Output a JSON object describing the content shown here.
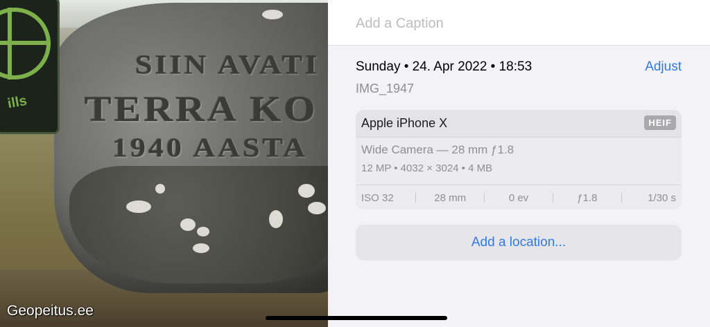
{
  "photo": {
    "inscription_lines": [
      "SIIN AVATI",
      "TERRA KO",
      "1940 AASTA"
    ],
    "patch_text": "ills",
    "watermark": "Geopeitus.ee"
  },
  "caption": {
    "placeholder": "Add a Caption",
    "value": ""
  },
  "info": {
    "datetime": "Sunday • 24. Apr 2022 • 18:53",
    "adjust_label": "Adjust",
    "filename": "IMG_1947"
  },
  "camera_card": {
    "device": "Apple iPhone X",
    "format_badge": "HEIF",
    "lens": "Wide Camera — 28 mm ƒ1.8",
    "specs": "12 MP  •  4032 × 3024  •  4 MB",
    "exif": {
      "iso": "ISO 32",
      "focal_length": "28 mm",
      "exposure_value": "0 ev",
      "aperture": "ƒ1.8",
      "shutter": "1/30 s"
    }
  },
  "location": {
    "label": "Add a location..."
  },
  "colors": {
    "accent": "#2f7ae5",
    "panel_bg": "#f2f2f7",
    "secondary_text": "#8e8e93"
  }
}
